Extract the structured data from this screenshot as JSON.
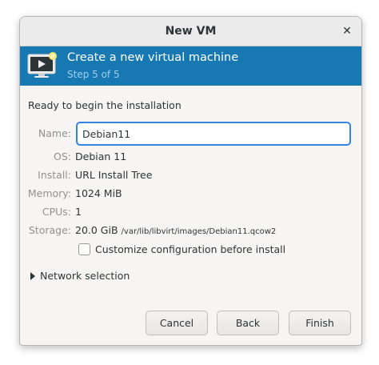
{
  "window": {
    "title": "New VM"
  },
  "header": {
    "title": "Create a new virtual machine",
    "step": "Step 5 of 5",
    "icon": "vm-monitor-icon"
  },
  "main": {
    "ready_text": "Ready to begin the installation",
    "name": {
      "label": "Name:",
      "value": "Debian11"
    },
    "details": [
      {
        "label": "OS:",
        "value": "Debian 11"
      },
      {
        "label": "Install:",
        "value": "URL Install Tree"
      },
      {
        "label": "Memory:",
        "value": "1024 MiB"
      },
      {
        "label": "CPUs:",
        "value": "1"
      }
    ],
    "storage": {
      "label": "Storage:",
      "size": "20.0 GiB",
      "path": "/var/lib/libvirt/images/Debian11.qcow2"
    },
    "customize_checkbox": {
      "label": "Customize configuration before install",
      "checked": false
    },
    "network_expander": {
      "label": "Network selection",
      "expanded": false
    }
  },
  "buttons": {
    "cancel": "Cancel",
    "back": "Back",
    "finish": "Finish"
  },
  "colors": {
    "header_bg": "#1878b2",
    "focus_border": "#3584e4",
    "window_bg": "#f6f5f4"
  }
}
